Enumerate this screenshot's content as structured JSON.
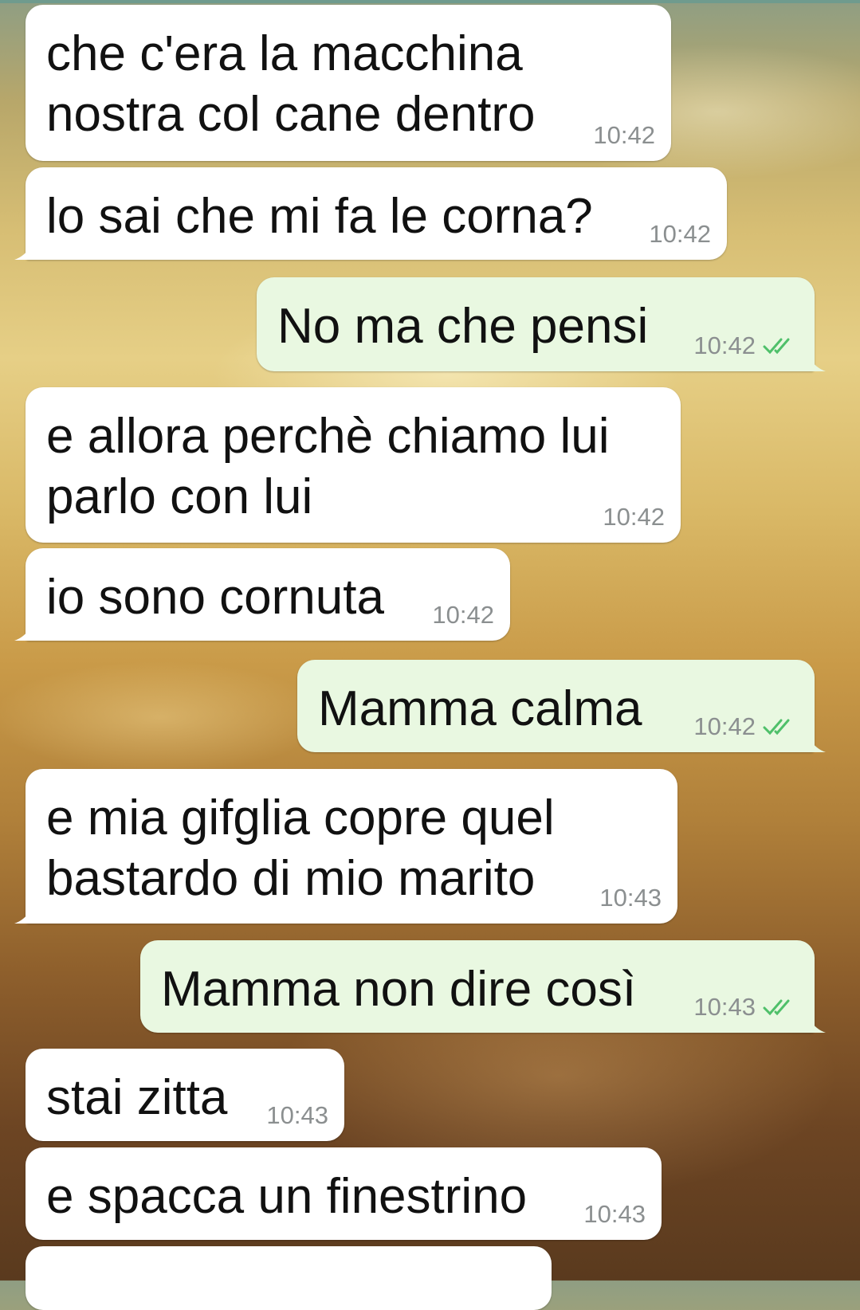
{
  "colors": {
    "incoming_bubble": "#ffffff",
    "outgoing_bubble": "#e9f8e1",
    "timestamp": "#8b8f90",
    "read_ticks": "#4fc06a"
  },
  "messages": [
    {
      "direction": "in",
      "lines": [
        "che c'era la macchina",
        "nostra col cane dentro"
      ],
      "time": "10:42",
      "status_icon": null
    },
    {
      "direction": "in",
      "lines": [
        "lo sai che mi fa le corna?"
      ],
      "time": "10:42",
      "status_icon": null
    },
    {
      "direction": "out",
      "lines": [
        "No ma che pensi"
      ],
      "time": "10:42",
      "status_icon": "double-check-icon"
    },
    {
      "direction": "in",
      "lines": [
        "e allora perchè chiamo lui",
        "parlo con lui"
      ],
      "time": "10:42",
      "status_icon": null
    },
    {
      "direction": "in",
      "lines": [
        "io sono cornuta"
      ],
      "time": "10:42",
      "status_icon": null
    },
    {
      "direction": "out",
      "lines": [
        "Mamma calma"
      ],
      "time": "10:42",
      "status_icon": "double-check-icon"
    },
    {
      "direction": "in",
      "lines": [
        "e mia gifglia copre quel",
        "bastardo di mio marito"
      ],
      "time": "10:43",
      "status_icon": null
    },
    {
      "direction": "out",
      "lines": [
        "Mamma non dire così"
      ],
      "time": "10:43",
      "status_icon": "double-check-icon"
    },
    {
      "direction": "in",
      "lines": [
        "stai zitta"
      ],
      "time": "10:43",
      "status_icon": null
    },
    {
      "direction": "in",
      "lines": [
        "e spacca un finestrino"
      ],
      "time": "10:43",
      "status_icon": null
    }
  ]
}
